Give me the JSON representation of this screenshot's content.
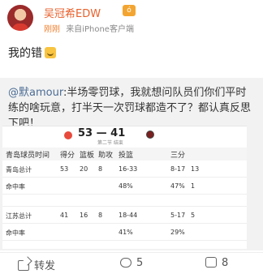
{
  "post": {
    "username": "吴冠希EDW",
    "badge_glyph": "ó",
    "time": "刚刚",
    "source": "来自iPhone客户端",
    "text": "我的错"
  },
  "retweet": {
    "mention": "@默amour",
    "text": ":半场零罚球，我就想问队员们你们平时练的啥玩意，打半天一次罚球都造不了？都认真反思下吧！"
  },
  "scoreboard": {
    "score": "53 — 41",
    "period": "第二节 结束",
    "colors": {
      "home": "#e84a3c",
      "away": "#7a2020"
    },
    "headers": [
      "青岛球员",
      "时间",
      "得分",
      "篮板",
      "助攻",
      "投篮",
      "三分"
    ],
    "rows": [
      {
        "name": "青岛总计",
        "time": "",
        "pts": "53",
        "reb": "20",
        "ast": "8",
        "fg": "16-33",
        "tp": "8-17",
        "extra": "13"
      },
      {
        "name": "命中率",
        "time": "",
        "pts": "",
        "reb": "",
        "ast": "",
        "fg": "48%",
        "tp": "47%",
        "extra": "1"
      },
      {
        "name": "",
        "time": "",
        "pts": "",
        "reb": "",
        "ast": "",
        "fg": "",
        "tp": "",
        "extra": ""
      },
      {
        "name": "江苏总计",
        "time": "",
        "pts": "41",
        "reb": "16",
        "ast": "8",
        "fg": "18-44",
        "tp": "5-17",
        "extra": "5"
      },
      {
        "name": "命中率",
        "time": "",
        "pts": "",
        "reb": "",
        "ast": "",
        "fg": "41%",
        "tp": "29%",
        "extra": ""
      }
    ]
  },
  "actions": {
    "share": "转发",
    "comment": "5",
    "like": "8",
    "icons": {
      "share": "share-icon",
      "comment": "comment-icon",
      "like": "like-icon"
    }
  }
}
